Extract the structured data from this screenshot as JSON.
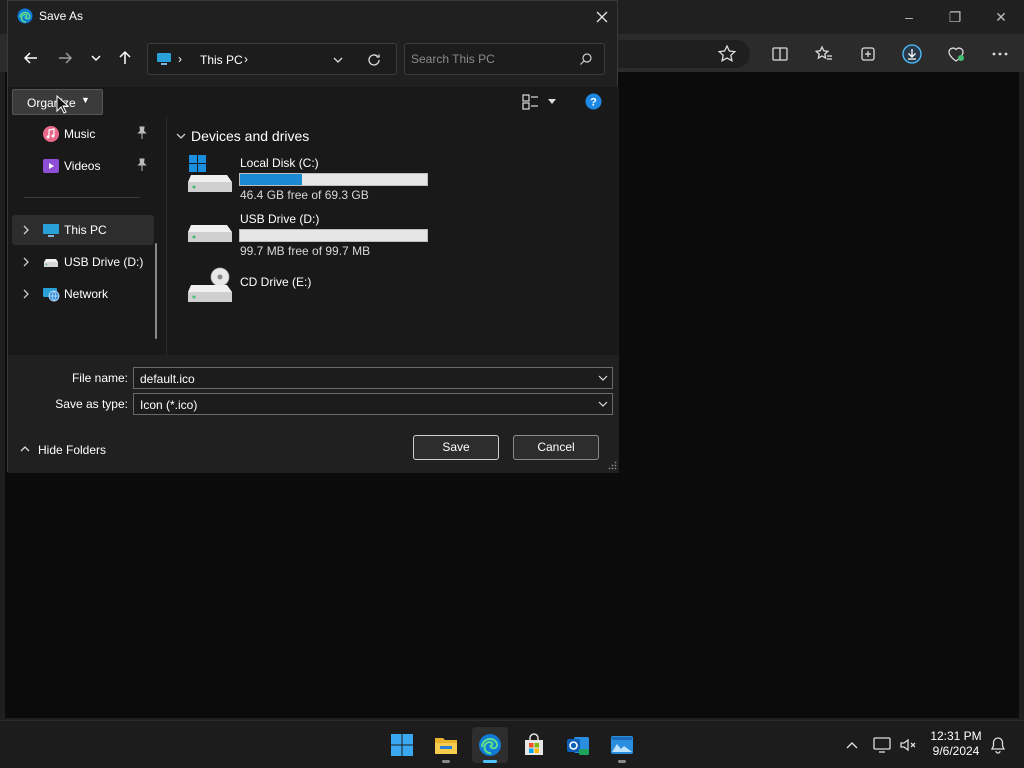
{
  "dialog": {
    "title": "Save As",
    "path_label": "This PC",
    "search_placeholder": "Search This PC",
    "organize_label": "Organize"
  },
  "sidebar": {
    "items": [
      {
        "label": "Music",
        "icon": "music-icon"
      },
      {
        "label": "Videos",
        "icon": "videos-icon"
      },
      {
        "label": "This PC",
        "icon": "this-pc-icon",
        "selected": true
      },
      {
        "label": "USB Drive (D:)",
        "icon": "usb-drive-icon"
      },
      {
        "label": "Network",
        "icon": "network-icon"
      }
    ]
  },
  "main": {
    "group_title": "Devices and drives",
    "drives": [
      {
        "name": "Local Disk (C:)",
        "free_text": "46.4 GB free of 69.3 GB",
        "used_fraction": 0.33
      },
      {
        "name": "USB Drive (D:)",
        "free_text": "99.7 MB free of 99.7 MB",
        "used_fraction": 0.0
      },
      {
        "name": "CD Drive (E:)",
        "free_text": ""
      }
    ]
  },
  "form": {
    "file_name_label": "File name:",
    "file_name_value": "default.ico",
    "save_type_label": "Save as type:",
    "save_type_value": "Icon (*.ico)",
    "hide_folders_label": "Hide Folders",
    "save_label": "Save",
    "cancel_label": "Cancel"
  },
  "taskbar": {
    "time": "12:31 PM",
    "date": "9/6/2024"
  },
  "colors": {
    "accent": "#1b8ad3",
    "edge_blue": "#0f7bd6"
  }
}
